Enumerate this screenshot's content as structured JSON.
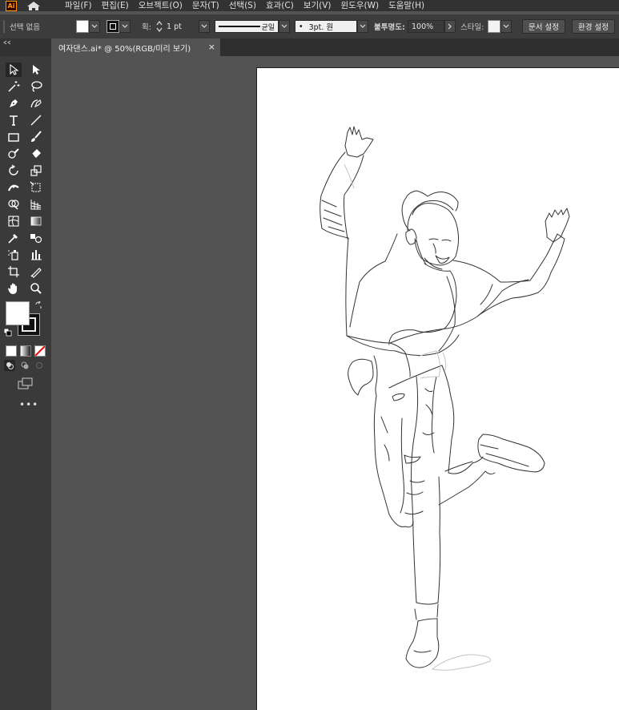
{
  "app": {
    "logo": "Ai"
  },
  "menu": [
    "파일(F)",
    "편집(E)",
    "오브젝트(O)",
    "문자(T)",
    "선택(S)",
    "효과(C)",
    "보기(V)",
    "윈도우(W)",
    "도움말(H)"
  ],
  "control": {
    "selection_state": "선택 없음",
    "stroke_label": "획:",
    "stroke_weight": "1 pt",
    "profile_label": "균일",
    "brush": "3pt. 원",
    "opacity_label": "불투명도:",
    "opacity_value": "100%",
    "style_label": "스타일:",
    "doc_setup": "문서 설정",
    "preferences": "환경 설정"
  },
  "document": {
    "tab_title": "여자댄스.ai* @ 50%(RGB/미리 보기)",
    "close": "×"
  },
  "colors": {
    "fill": "#ffffff",
    "stroke": "#000000",
    "accent": "#ff9a00"
  }
}
